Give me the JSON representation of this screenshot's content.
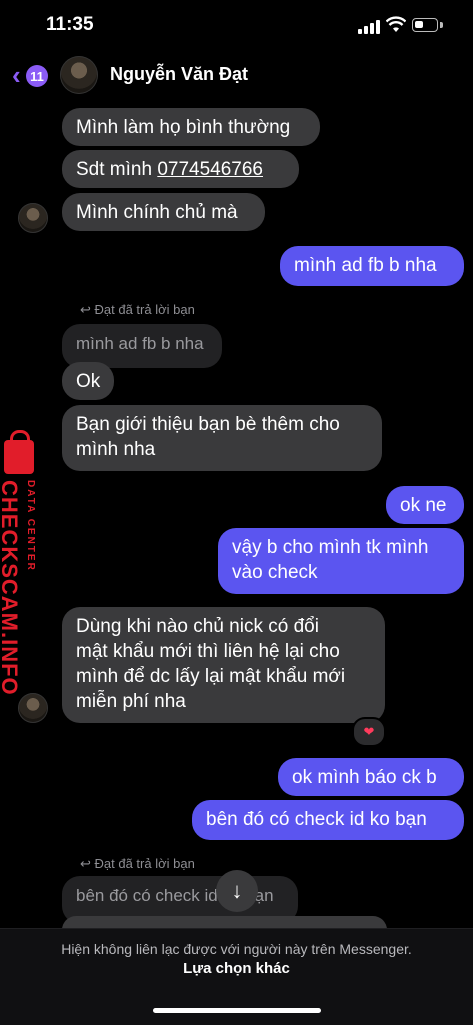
{
  "status": {
    "time": "11:35"
  },
  "header": {
    "back_badge": "11",
    "contact_name": "Nguyễn Văn Đạt"
  },
  "messages": {
    "m1": "Mình làm họ bình thường",
    "m2_prefix": "Sdt mình ",
    "m2_phone": "0774546766",
    "m3": "Mình chính chủ mà",
    "m4": "mình ad fb b nha",
    "reply1_note": "Đạt đã trả lời bạn",
    "reply1_quote": "mình ad fb b nha",
    "m5": "Ok",
    "m6_line1": "Bạn giới thiệu bạn bè thêm cho",
    "m6_line2": "mình nha",
    "m7": "ok ne",
    "m8_line1": "vậy b cho mình tk mình",
    "m8_line2": "vào check",
    "m9_line1": "Dùng khi nào chủ nick có đổi",
    "m9_line2": "mật khẩu mới thì liên hệ lại cho",
    "m9_line3": "mình để dc lấy lại mật khẩu mới",
    "m9_line4": "miễn phí nha",
    "m9_reaction": "❤",
    "m10": "ok mình báo ck b",
    "m11": "bên đó có check id ko bạn",
    "reply2_note": "Đạt đã trả lời bạn",
    "reply2_quote": "bên đó có check id ko bạn"
  },
  "footer": {
    "notice": "Hiện không liên lạc được với người này trên Messenger.",
    "action": "Lựa chọn khác"
  },
  "watermark": {
    "brand": "CHECKSCAM.INFO",
    "sub": "DATA CENTER"
  },
  "colors": {
    "accent": "#8b5cf6",
    "outgoing_bubble": "#5b55f0",
    "incoming_bubble": "#3a3a3c",
    "watermark": "#e11d2a"
  }
}
